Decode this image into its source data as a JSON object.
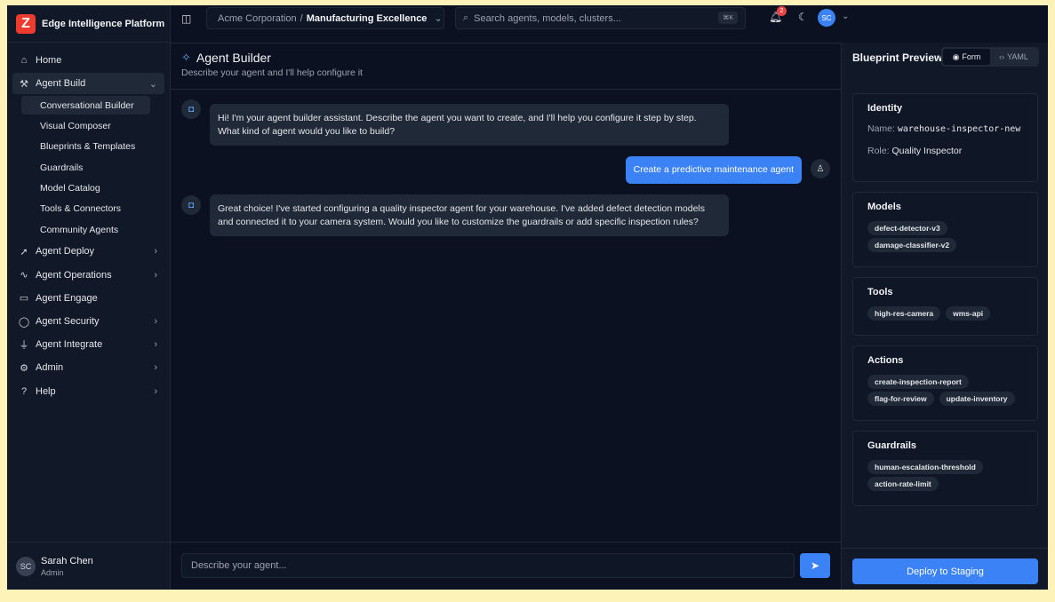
{
  "brand": {
    "name": "Edge Intelligence Platform",
    "logo_letter": "Z"
  },
  "sidebar": {
    "items": [
      {
        "label": "Home",
        "icon": "home-icon",
        "glyph": "⌂"
      },
      {
        "label": "Agent Build",
        "icon": "hammer-icon",
        "glyph": "⚒",
        "expanded": true
      },
      {
        "label": "Agent Deploy",
        "icon": "rocket-icon",
        "glyph": "➚"
      },
      {
        "label": "Agent Operations",
        "icon": "activity-icon",
        "glyph": "∿"
      },
      {
        "label": "Agent Engage",
        "icon": "message-icon",
        "glyph": "▭"
      },
      {
        "label": "Agent Security",
        "icon": "shield-icon",
        "glyph": "◯"
      },
      {
        "label": "Agent Integrate",
        "icon": "plug-icon",
        "glyph": "⏚"
      },
      {
        "label": "Admin",
        "icon": "gear-icon",
        "glyph": "⚙"
      },
      {
        "label": "Help",
        "icon": "help-icon",
        "glyph": "?"
      }
    ],
    "subitems": [
      "Conversational Builder",
      "Visual Composer",
      "Blueprints & Templates",
      "Guardrails",
      "Model Catalog",
      "Tools & Connectors",
      "Community Agents"
    ],
    "user": {
      "initials": "SC",
      "name": "Sarah Chen",
      "role": "Admin"
    }
  },
  "topbar": {
    "org": "Acme Corporation",
    "separator": "/",
    "workspace": "Manufacturing Excellence",
    "search_placeholder": "Search agents, models, clusters...",
    "shortcut": "⌘K",
    "notification_count": "2",
    "avatar_initials": "SC"
  },
  "main": {
    "title": "Agent Builder",
    "subtitle": "Describe your agent and I'll help configure it",
    "messages": [
      {
        "role": "bot",
        "text": "Hi! I'm your agent builder assistant. Describe the agent you want to create, and I'll help you configure it step by step. What kind of agent would you like to build?"
      },
      {
        "role": "user",
        "text": "Create a predictive maintenance agent"
      },
      {
        "role": "bot",
        "text": "Great choice! I've started configuring a quality inspector agent for your warehouse. I've added defect detection models and connected it to your camera system. Would you like to customize the guardrails or add specific inspection rules?"
      }
    ],
    "composer_placeholder": "Describe your agent..."
  },
  "preview": {
    "title": "Blueprint Preview",
    "toggle": {
      "form": "Form",
      "yaml": "YAML",
      "selected": "Form"
    },
    "identity": {
      "title": "Identity",
      "name_label": "Name:",
      "name_value": "warehouse-inspector-new",
      "role_label": "Role:",
      "role_value": "Quality Inspector"
    },
    "models": {
      "title": "Models",
      "chips": [
        "defect-detector-v3",
        "damage-classifier-v2"
      ]
    },
    "tools": {
      "title": "Tools",
      "chips": [
        "high-res-camera",
        "wms-api"
      ]
    },
    "actions": {
      "title": "Actions",
      "chips": [
        "create-inspection-report",
        "flag-for-review",
        "update-inventory"
      ]
    },
    "guardrails": {
      "title": "Guardrails",
      "chips": [
        "human-escalation-threshold",
        "action-rate-limit"
      ]
    },
    "deploy_label": "Deploy to Staging"
  },
  "colors": {
    "accent": "#3b82f6",
    "background": "#0b1120",
    "panel": "#111827",
    "logo": "#ef3b2d"
  }
}
